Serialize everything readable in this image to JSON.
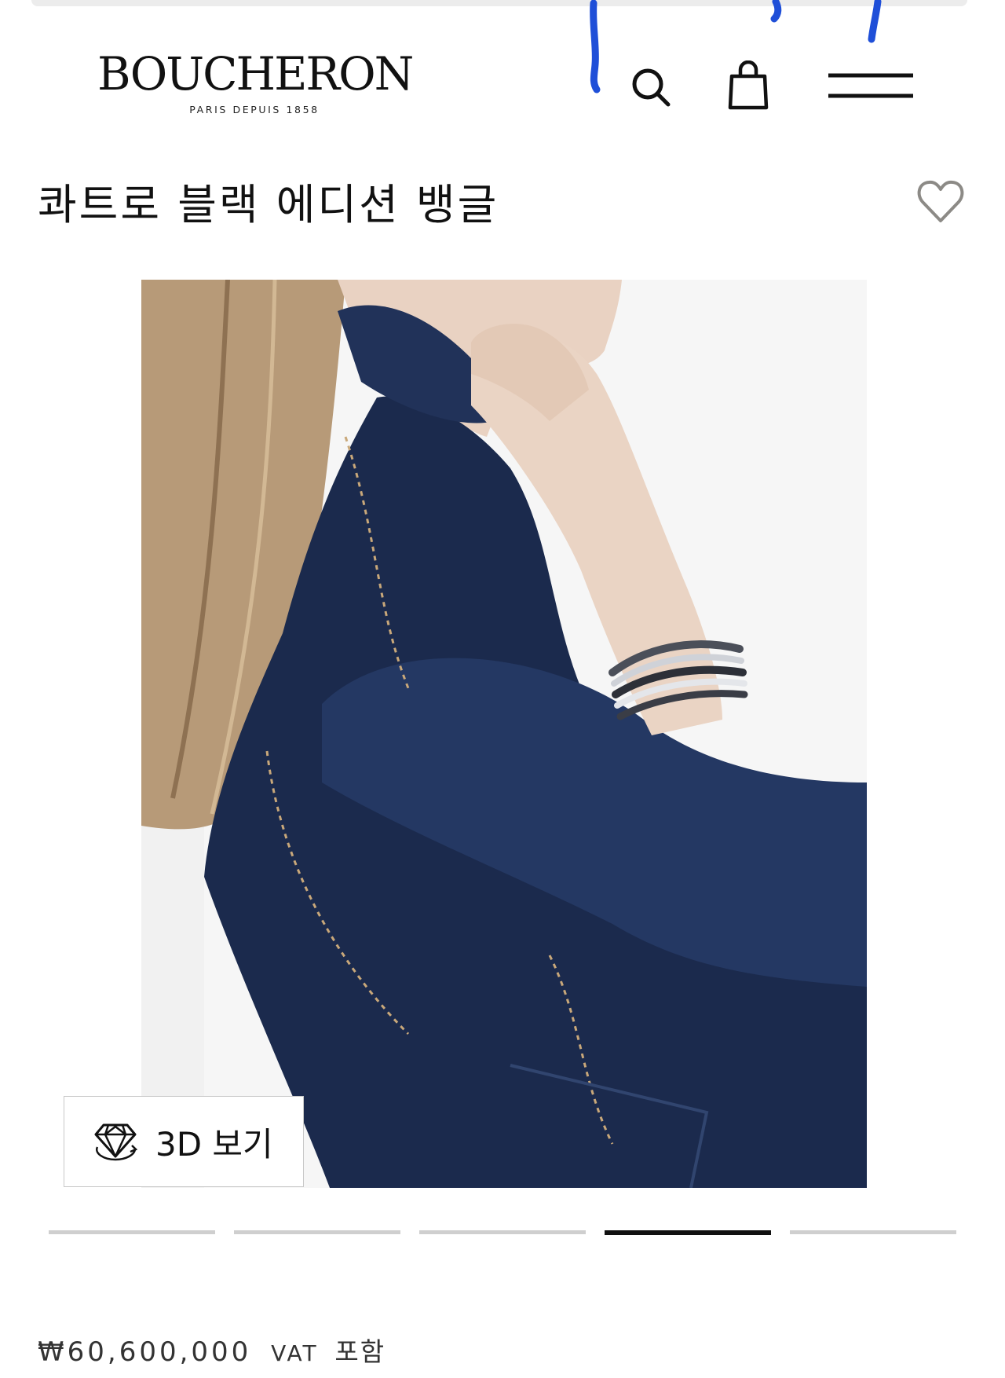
{
  "header": {
    "brand": "BOUCHERON",
    "tagline": "PARIS DEPUIS 1858",
    "icons": [
      "search-icon",
      "shopping-bag-icon",
      "menu-icon"
    ]
  },
  "product": {
    "title": "콰트로 블랙 에디션 뱅글",
    "wishlist_icon": "heart-outline-icon",
    "view_3d_label": "3D 보기",
    "view_3d_icon": "diamond-rotate-icon",
    "price": "₩60,600,000",
    "price_vat": "VAT",
    "price_vat_note": "포함"
  },
  "gallery": {
    "slides_count": 5,
    "active_slide": 4
  },
  "colors": {
    "annotation_blue": "#1f4fd8",
    "text": "#111111",
    "pager_inactive": "#cfcfcf",
    "pager_active": "#111111"
  }
}
